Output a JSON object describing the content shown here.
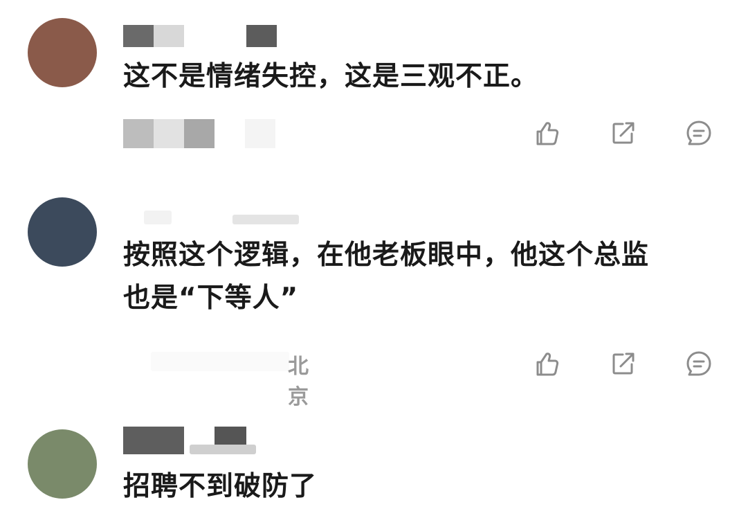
{
  "comments": [
    {
      "text": "这不是情绪失控，这是三观不正。",
      "location": "",
      "avatar_palette": [
        "#8a5a4a",
        "#b87c68",
        "#c9937f",
        "#a86a58",
        "#6e4438"
      ]
    },
    {
      "text": "按照这个逻辑，在他老板眼中，他这个总监\n也是“下等人”",
      "location": "北京",
      "avatar_palette": [
        "#3c4a5c",
        "#6b7f94",
        "#2a3340",
        "#8a97a8",
        "#5a3a44"
      ]
    },
    {
      "text": "招聘不到破防了",
      "location": "",
      "avatar_palette": [
        "#7a8a6a",
        "#c6a88a",
        "#d9b89a",
        "#8e9e80",
        "#b08a78"
      ]
    }
  ],
  "actions": {
    "like_icon": "thumbs-up-icon",
    "share_icon": "share-icon",
    "reply_icon": "comment-bubble-icon"
  },
  "colors": {
    "text": "#1a1a1a",
    "icon": "#8c8c8c",
    "meta": "#9a9a9a"
  }
}
